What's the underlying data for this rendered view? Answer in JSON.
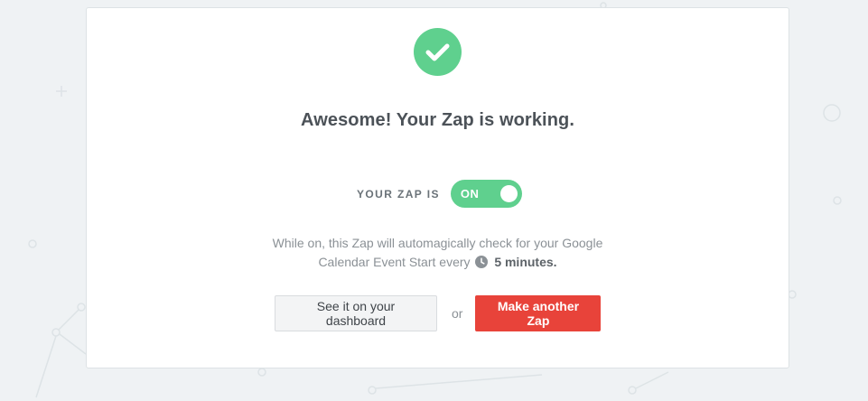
{
  "success": {
    "icon": "checkmark-circle-icon",
    "headline": "Awesome! Your Zap is working."
  },
  "status": {
    "label": "YOUR ZAP IS",
    "toggle_text": "ON",
    "toggle_state": "on"
  },
  "description": {
    "line1": "While on, this Zap will automagically check for your Google",
    "line2_prefix": "Calendar Event Start every",
    "clock_icon": "clock-icon",
    "interval": "5 minutes."
  },
  "actions": {
    "dashboard_label": "See it on your dashboard",
    "or_text": "or",
    "make_zap_label": "Make another Zap"
  },
  "colors": {
    "success_green": "#5fd08e",
    "primary_red": "#e8433a",
    "background": "#eff2f4"
  }
}
